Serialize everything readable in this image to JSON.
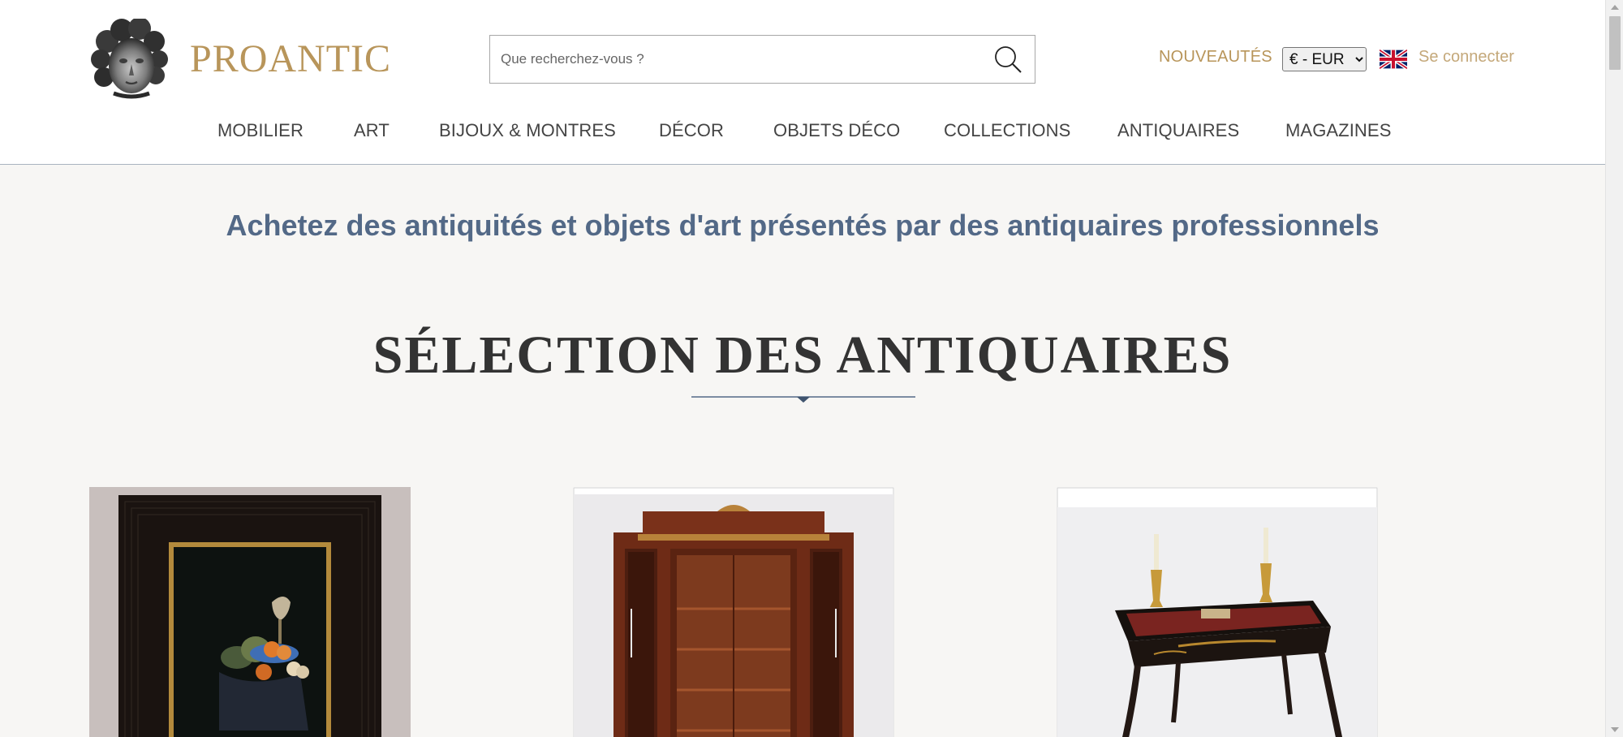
{
  "header": {
    "logo_text": "PROANTIC",
    "search": {
      "placeholder": "Que recherchez-vous ?",
      "value": ""
    },
    "nouveautes": "NOUVEAUTÉS",
    "currency": {
      "selected": "€ - EUR",
      "options": [
        "€ - EUR"
      ]
    },
    "language_flag": "uk-flag-icon",
    "login": "Se connecter"
  },
  "nav": {
    "items": [
      {
        "label": "MOBILIER"
      },
      {
        "label": "ART"
      },
      {
        "label": "BIJOUX & MONTRES"
      },
      {
        "label": "DÉCOR"
      },
      {
        "label": "OBJETS DÉCO"
      },
      {
        "label": "COLLECTIONS"
      },
      {
        "label": "ANTIQUAIRES"
      },
      {
        "label": "MAGAZINES"
      }
    ]
  },
  "main": {
    "tagline": "Achetez des antiquités et objets d'art présentés par des antiquaires professionnels",
    "section_title": "SÉLECTION DES ANTIQUAIRES"
  },
  "colors": {
    "brand_gold": "#b8955a",
    "tagline_blue": "#536987",
    "background": "#f7f6f4"
  }
}
